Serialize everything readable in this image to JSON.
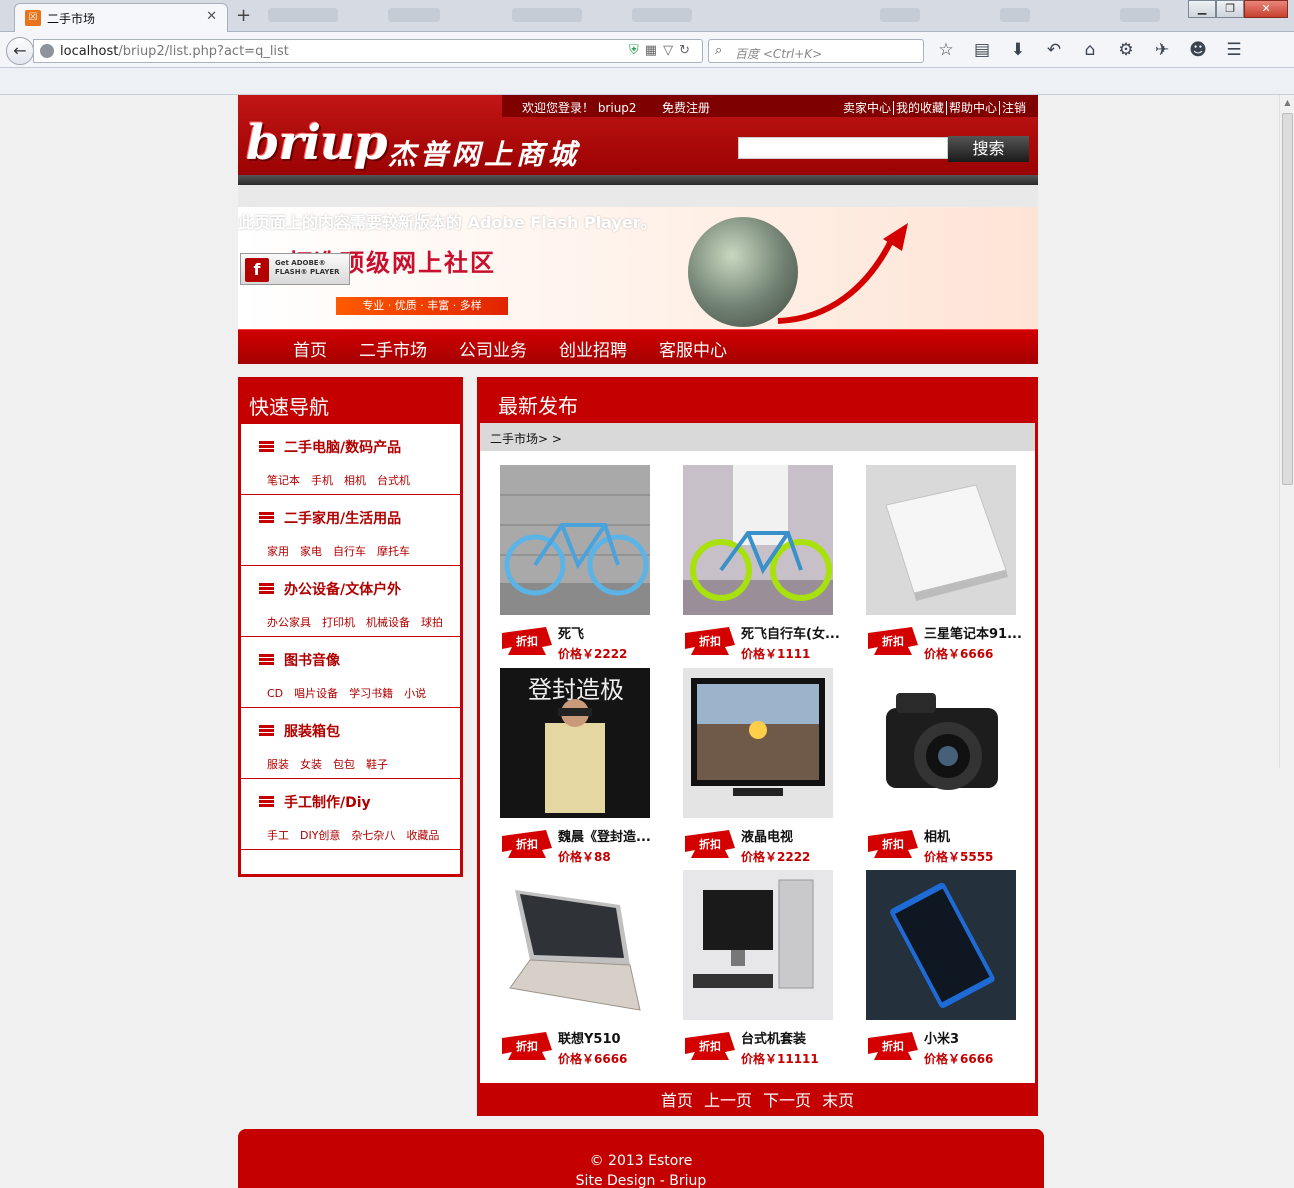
{
  "browser": {
    "tab_title": "二手市场",
    "tab_close": "✕",
    "new_tab": "+",
    "url_host": "localhost",
    "url_path": "/briup2/list.php?act=q_list",
    "search_placeholder": "百度 <Ctrl+K>",
    "window_controls": [
      "▁",
      "❐",
      "✕"
    ]
  },
  "site": {
    "welcome": "欢迎您登录！ briup2",
    "register": "免费注册",
    "top_links": [
      "卖家中心",
      "我的收藏",
      "帮助中心",
      "注销"
    ],
    "logo_text": "briup",
    "logo_cn": "杰普网上商城",
    "search_button": "搜索",
    "search_value": ""
  },
  "banner": {
    "flash_warning": "此页面上的内容需要较新版本的 Adobe Flash Player。",
    "slogan": "打造顶级网上社区",
    "sub_slogan": "专业 · 优质 · 丰富 · 多样",
    "flash_badge": "Get ADOBE® FLASH® PLAYER"
  },
  "nav": [
    "首页",
    "二手市场",
    "公司业务",
    "创业招聘",
    "客服中心"
  ],
  "sidebar": {
    "title": "快速导航",
    "categories": [
      {
        "title": "二手电脑/数码产品",
        "subs": [
          "笔记本",
          "手机",
          "相机",
          "台式机"
        ]
      },
      {
        "title": "二手家用/生活用品",
        "subs": [
          "家用",
          "家电",
          "自行车",
          "摩托车"
        ]
      },
      {
        "title": "办公设备/文体户外",
        "subs": [
          "办公家具",
          "打印机",
          "机械设备",
          "球拍"
        ]
      },
      {
        "title": "图书音像",
        "subs": [
          "CD",
          "唱片设备",
          "学习书籍",
          "小说"
        ]
      },
      {
        "title": "服装箱包",
        "subs": [
          "服装",
          "女装",
          "包包",
          "鞋子"
        ]
      },
      {
        "title": "手工制作/Diy",
        "subs": [
          "手工",
          "DIY创意",
          "杂七杂八",
          "收藏品"
        ]
      }
    ]
  },
  "main": {
    "title": "最新发布",
    "breadcrumb": "二手市场> >",
    "discount_tag": "折扣",
    "products": [
      {
        "name": "死飞",
        "price": "价格￥2222",
        "image": "blue-bike"
      },
      {
        "name": "死飞自行车(女...",
        "price": "价格￥1111",
        "image": "green-bike"
      },
      {
        "name": "三星笔记本91...",
        "price": "价格￥6666",
        "image": "white-laptop"
      },
      {
        "name": "魏晨《登封造...",
        "price": "价格￥88",
        "image": "album-cover"
      },
      {
        "name": "液晶电视",
        "price": "价格￥2222",
        "image": "lcd-tv"
      },
      {
        "name": "相机",
        "price": "价格￥5555",
        "image": "camera"
      },
      {
        "name": "联想Y510",
        "price": "价格￥6666",
        "image": "laptop"
      },
      {
        "name": "台式机套装",
        "price": "价格￥11111",
        "image": "desktop-set"
      },
      {
        "name": "小米3",
        "price": "价格￥6666",
        "image": "phone"
      }
    ],
    "pager": [
      "首页",
      "上一页",
      "下一页",
      "末页"
    ]
  },
  "footer": {
    "copyright": "© 2013 Estore",
    "credit": "Site Design - Briup"
  }
}
